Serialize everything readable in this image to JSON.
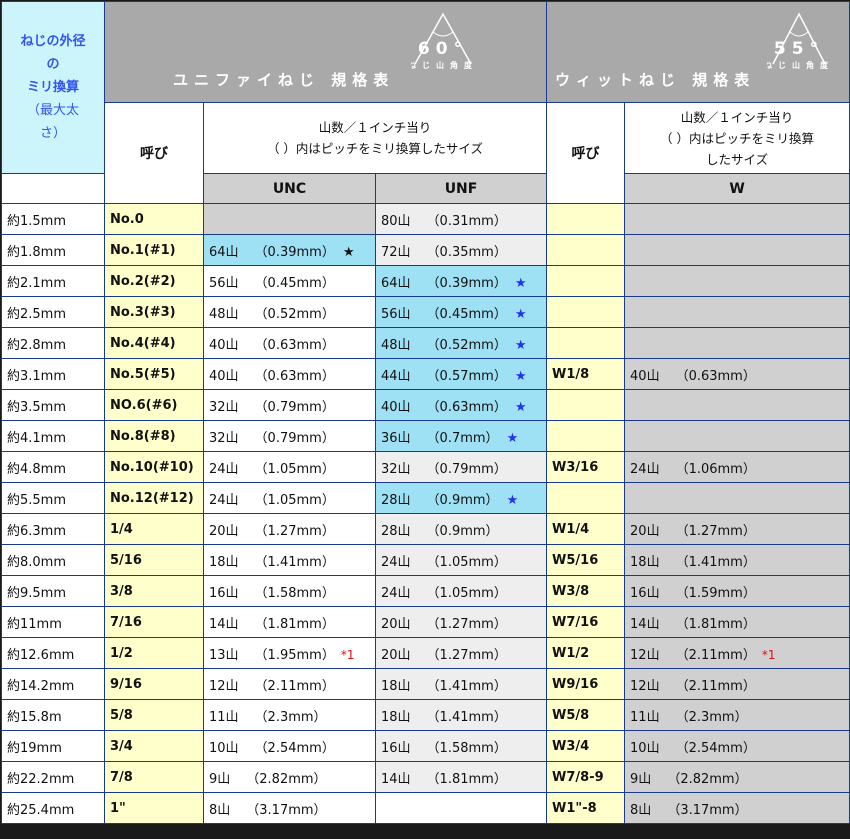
{
  "header": {
    "diam_lines": [
      "ねじの外径",
      "の",
      "ミリ換算"
    ],
    "diam_sub": [
      "（最大太",
      "さ）"
    ],
    "unified_title": "ユニファイねじ 規格表",
    "unified_angle": "60°",
    "whitworth_title": "ウィットねじ 規格表",
    "whitworth_angle": "55°",
    "angle_caption": "ねじ山角度",
    "call_label": "呼び",
    "unified_desc": [
      "山数／１インチ当り",
      "（ ）内はピッチをミリ換算したサイズ"
    ],
    "whitworth_desc": [
      "山数／１インチ当り",
      "（ ）内はピッチをミリ換算",
      "したサイズ"
    ],
    "col_unc": "UNC",
    "col_unf": "UNF",
    "col_w": "W"
  },
  "colors": {
    "border": "#1a3a8f",
    "cyan_header": "#ccf5fb",
    "title_gray": "#a9a9a9",
    "call_yellow": "#ffffcc",
    "highlight_blue": "#9ee0f4",
    "star_blue": "#2233ee",
    "note_red": "#d11111"
  },
  "rows": [
    {
      "diam": "約1.5mm",
      "call": "No.0",
      "unc": {
        "t": "",
        "p": ""
      },
      "unf": {
        "t": "80山",
        "p": "（0.31mm）"
      },
      "wcall": "",
      "w": {
        "t": "",
        "p": ""
      }
    },
    {
      "diam": "約1.8mm",
      "call": "No.1(#1)",
      "unc": {
        "t": "64山",
        "p": "（0.39mm）",
        "star": "★",
        "hl": true
      },
      "unf": {
        "t": "72山",
        "p": "（0.35mm）"
      },
      "wcall": "",
      "w": {
        "t": "",
        "p": ""
      }
    },
    {
      "diam": "約2.1mm",
      "call": "No.2(#2)",
      "unc": {
        "t": "56山",
        "p": "（0.45mm）"
      },
      "unf": {
        "t": "64山",
        "p": "（0.39mm）",
        "star": "★",
        "hl": true
      },
      "wcall": "",
      "w": {
        "t": "",
        "p": ""
      }
    },
    {
      "diam": "約2.5mm",
      "call": "No.3(#3)",
      "unc": {
        "t": "48山",
        "p": "（0.52mm）"
      },
      "unf": {
        "t": "56山",
        "p": "（0.45mm）",
        "star": "★",
        "hl": true
      },
      "wcall": "",
      "w": {
        "t": "",
        "p": ""
      }
    },
    {
      "diam": "約2.8mm",
      "call": "No.4(#4)",
      "unc": {
        "t": "40山",
        "p": "（0.63mm）"
      },
      "unf": {
        "t": "48山",
        "p": "（0.52mm）",
        "star": "★",
        "hl": true
      },
      "wcall": "",
      "w": {
        "t": "",
        "p": ""
      }
    },
    {
      "diam": "約3.1mm",
      "call": "No.5(#5)",
      "unc": {
        "t": "40山",
        "p": "（0.63mm）"
      },
      "unf": {
        "t": "44山",
        "p": "（0.57mm）",
        "star": "★",
        "hl": true
      },
      "wcall": "W1/8",
      "w": {
        "t": "40山",
        "p": "（0.63mm）"
      }
    },
    {
      "diam": "約3.5mm",
      "call": "NO.6(#6)",
      "unc": {
        "t": "32山",
        "p": "（0.79mm）"
      },
      "unf": {
        "t": "40山",
        "p": "（0.63mm）",
        "star": "★",
        "hl": true
      },
      "wcall": "",
      "w": {
        "t": "",
        "p": ""
      }
    },
    {
      "diam": "約4.1mm",
      "call": "No.8(#8)",
      "unc": {
        "t": "32山",
        "p": "（0.79mm）"
      },
      "unf": {
        "t": "36山",
        "p": "（0.7mm）",
        "star": "★",
        "hl": true
      },
      "wcall": "",
      "w": {
        "t": "",
        "p": ""
      }
    },
    {
      "diam": "約4.8mm",
      "call": "No.10(#10)",
      "unc": {
        "t": "24山",
        "p": "（1.05mm）"
      },
      "unf": {
        "t": "32山",
        "p": "（0.79mm）"
      },
      "wcall": "W3/16",
      "w": {
        "t": "24山",
        "p": "（1.06mm）"
      }
    },
    {
      "diam": "約5.5mm",
      "call": "No.12(#12)",
      "unc": {
        "t": "24山",
        "p": "（1.05mm）"
      },
      "unf": {
        "t": "28山",
        "p": "（0.9mm）",
        "star": "★",
        "hl": true
      },
      "wcall": "",
      "w": {
        "t": "",
        "p": ""
      }
    },
    {
      "diam": "約6.3mm",
      "call": "1/4",
      "unc": {
        "t": "20山",
        "p": "（1.27mm）"
      },
      "unf": {
        "t": "28山",
        "p": "（0.9mm）"
      },
      "wcall": "W1/4",
      "w": {
        "t": "20山",
        "p": "（1.27mm）"
      }
    },
    {
      "diam": "約8.0mm",
      "call": "5/16",
      "unc": {
        "t": "18山",
        "p": "（1.41mm）"
      },
      "unf": {
        "t": "24山",
        "p": "（1.05mm）"
      },
      "wcall": "W5/16",
      "w": {
        "t": "18山",
        "p": "（1.41mm）"
      }
    },
    {
      "diam": "約9.5mm",
      "call": "3/8",
      "unc": {
        "t": "16山",
        "p": "（1.58mm）"
      },
      "unf": {
        "t": "24山",
        "p": "（1.05mm）"
      },
      "wcall": "W3/8",
      "w": {
        "t": "16山",
        "p": "（1.59mm）"
      }
    },
    {
      "diam": "約11mm",
      "call": "7/16",
      "unc": {
        "t": "14山",
        "p": "（1.81mm）"
      },
      "unf": {
        "t": "20山",
        "p": "（1.27mm）"
      },
      "wcall": "W7/16",
      "w": {
        "t": "14山",
        "p": "（1.81mm）"
      }
    },
    {
      "diam": "約12.6mm",
      "call": "1/2",
      "unc": {
        "t": "13山",
        "p": "（1.95mm）",
        "note": "*1"
      },
      "unf": {
        "t": "20山",
        "p": "（1.27mm）"
      },
      "wcall": "W1/2",
      "w": {
        "t": "12山",
        "p": "（2.11mm）",
        "note": "*1"
      }
    },
    {
      "diam": "約14.2mm",
      "call": "9/16",
      "unc": {
        "t": "12山",
        "p": "（2.11mm）"
      },
      "unf": {
        "t": "18山",
        "p": "（1.41mm）"
      },
      "wcall": "W9/16",
      "w": {
        "t": "12山",
        "p": "（2.11mm）"
      }
    },
    {
      "diam": "約15.8m",
      "call": "5/8",
      "unc": {
        "t": "11山",
        "p": "（2.3mm）"
      },
      "unf": {
        "t": "18山",
        "p": "（1.41mm）"
      },
      "wcall": "W5/8",
      "w": {
        "t": "11山",
        "p": "（2.3mm）"
      }
    },
    {
      "diam": "約19mm",
      "call": "3/4",
      "unc": {
        "t": "10山",
        "p": "（2.54mm）"
      },
      "unf": {
        "t": "16山",
        "p": "（1.58mm）"
      },
      "wcall": "W3/4",
      "w": {
        "t": "10山",
        "p": "（2.54mm）"
      }
    },
    {
      "diam": "約22.2mm",
      "call": "7/8",
      "unc": {
        "t": "9山",
        "p": "（2.82mm）"
      },
      "unf": {
        "t": "14山",
        "p": "（1.81mm）"
      },
      "wcall": "W7/8-9",
      "w": {
        "t": "9山",
        "p": "（2.82mm）"
      }
    },
    {
      "diam": "約25.4mm",
      "call": "1\"",
      "unc": {
        "t": "8山",
        "p": "（3.17mm）"
      },
      "unf": {
        "t": "",
        "p": ""
      },
      "wcall": "W1\"-8",
      "w": {
        "t": "8山",
        "p": "（3.17mm）"
      }
    }
  ]
}
